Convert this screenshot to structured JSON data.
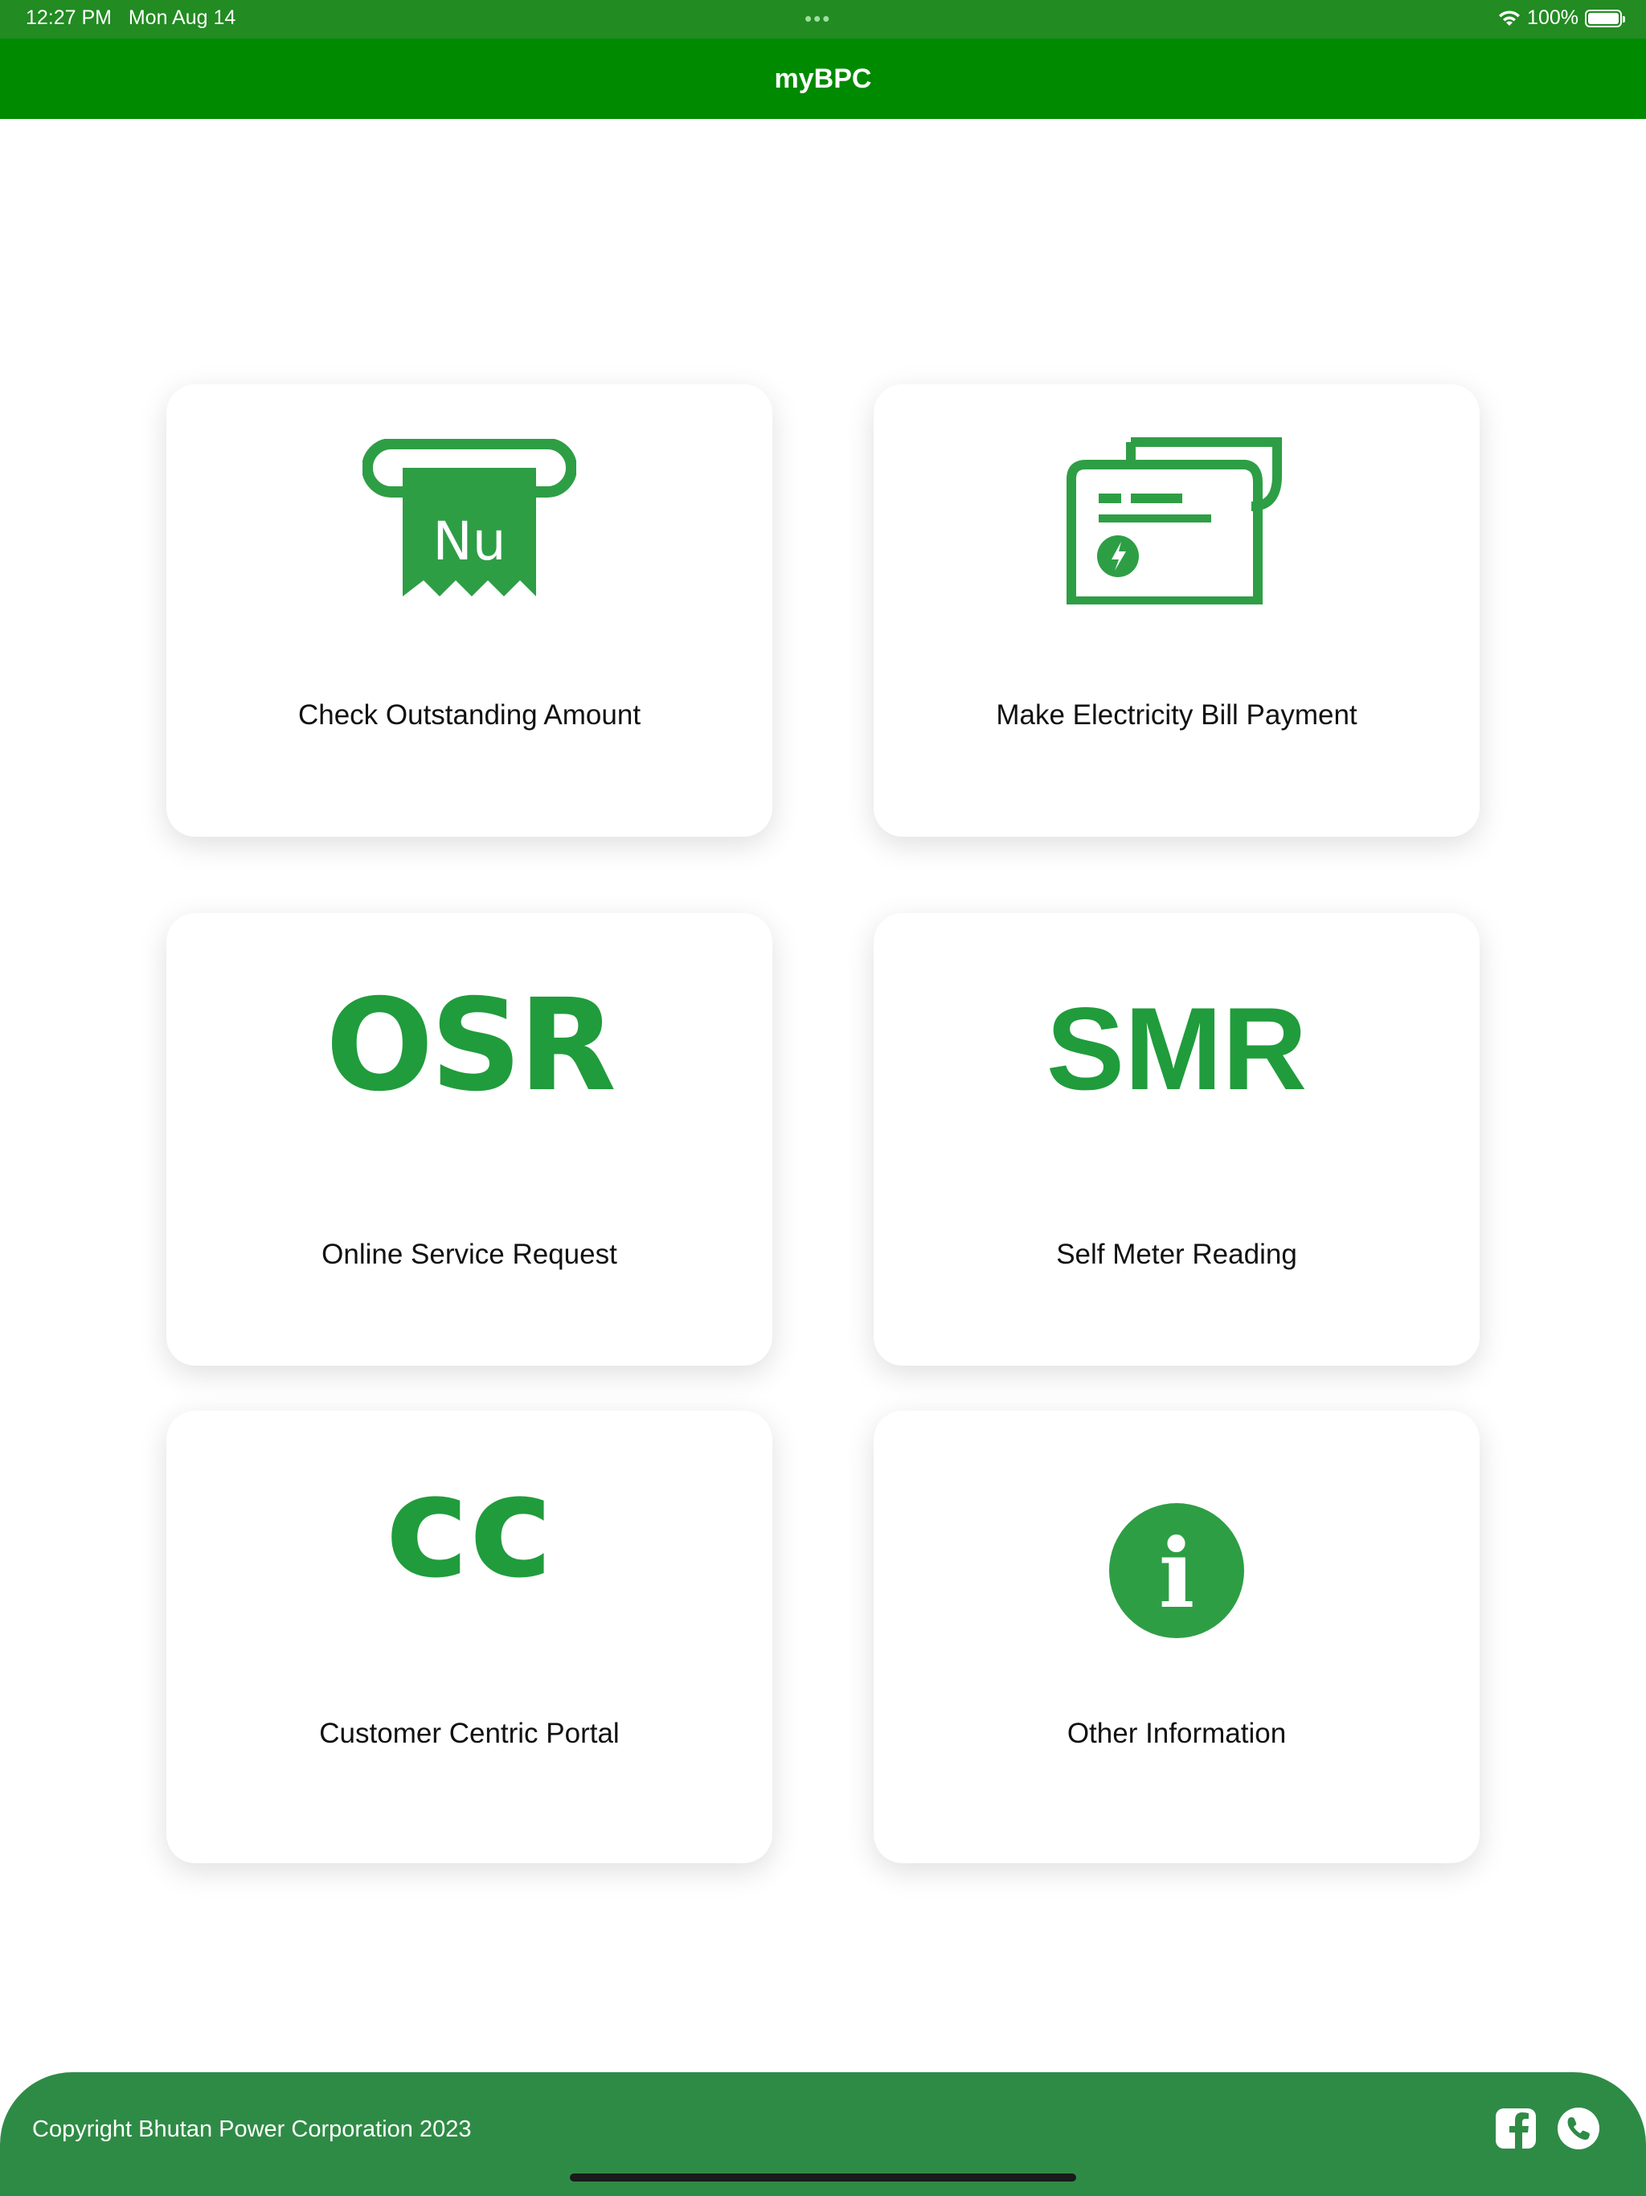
{
  "status_bar": {
    "time": "12:27 PM",
    "date": "Mon Aug 14",
    "dots": "•••",
    "battery_text": "100%"
  },
  "app": {
    "title": "myBPC"
  },
  "cards": [
    {
      "label": "Check Outstanding Amount",
      "icon": "receipt-nu-icon",
      "icon_text": "Nu"
    },
    {
      "label": "Make Electricity Bill Payment",
      "icon": "bill-payment-icon"
    },
    {
      "label": "Online Service Request",
      "icon": "osr-icon",
      "icon_text": "OSR"
    },
    {
      "label": "Self Meter Reading",
      "icon": "smr-icon",
      "icon_text": "SMR"
    },
    {
      "label": "Customer Centric Portal",
      "icon": "cc-icon",
      "icon_text": "cc"
    },
    {
      "label": "Other Information",
      "icon": "info-icon",
      "icon_text": "i"
    }
  ],
  "footer": {
    "copyright": "Copyright Bhutan Power Corporation 2023",
    "icons": [
      "facebook-icon",
      "phone-icon"
    ]
  },
  "colors": {
    "status_bar": "#228B22",
    "nav_bar": "#008A00",
    "icon_green": "#209C3C",
    "footer": "#2E8B45"
  }
}
